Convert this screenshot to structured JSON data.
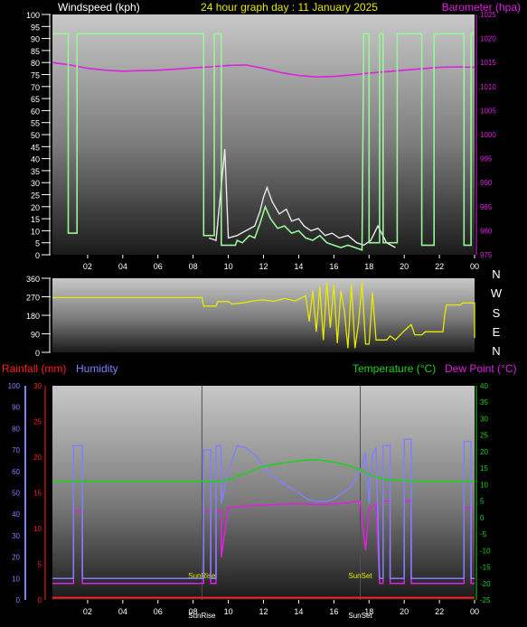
{
  "title": "24 hour graph day : 11 January 2025",
  "colors": {
    "windspeed": "#98f598",
    "gust": "#e8e8e8",
    "windspeed_label": "#ffffff",
    "barometer": "#e020e0",
    "title": "#e8e800",
    "direction": "#e8e800",
    "rain": "#ff2020",
    "humidity": "#8080ff",
    "temperature": "#20d020",
    "dewpoint": "#e020e0",
    "axis_text": "#ffffff",
    "sun_text": "#e8e800"
  },
  "hour_ticks": [
    "02",
    "04",
    "06",
    "08",
    "10",
    "12",
    "14",
    "16",
    "18",
    "20",
    "22",
    "00"
  ],
  "chart_data": [
    {
      "type": "line",
      "name": "wind-barometer",
      "title": "24 hour graph day : 11 January 2025",
      "left_label": "Windspeed (kph)",
      "right_label": "Barometer (hpa)",
      "left_ticks": [
        "100",
        "95",
        "90",
        "85",
        "80",
        "75",
        "70",
        "65",
        "60",
        "55",
        "50",
        "45",
        "40",
        "35",
        "30",
        "25",
        "20",
        "15",
        "10",
        "5",
        "0"
      ],
      "right_ticks": [
        "1025",
        "1020",
        "1015",
        "1010",
        "1005",
        "1000",
        "995",
        "990",
        "985",
        "980",
        "975"
      ],
      "ylim_left": [
        0,
        100
      ],
      "ylim_right": [
        975,
        1025
      ],
      "x_range_hours": [
        0,
        24
      ],
      "wind_avg": [
        [
          0,
          92
        ],
        [
          0.9,
          92
        ],
        [
          0.9,
          9
        ],
        [
          1.4,
          9
        ],
        [
          1.4,
          92
        ],
        [
          8.6,
          92
        ],
        [
          8.6,
          8
        ],
        [
          9.2,
          8
        ],
        [
          9.2,
          92
        ],
        [
          9.6,
          92
        ],
        [
          9.6,
          4
        ],
        [
          10.4,
          4
        ],
        [
          10.5,
          6
        ],
        [
          10.8,
          5
        ],
        [
          11.2,
          8
        ],
        [
          11.5,
          7
        ],
        [
          11.8,
          13
        ],
        [
          12.1,
          20
        ],
        [
          12.4,
          15
        ],
        [
          12.8,
          11
        ],
        [
          13.2,
          12
        ],
        [
          13.6,
          9
        ],
        [
          14.0,
          10
        ],
        [
          14.4,
          7
        ],
        [
          14.8,
          6
        ],
        [
          15.2,
          8
        ],
        [
          15.6,
          5
        ],
        [
          16.0,
          4
        ],
        [
          16.4,
          3
        ],
        [
          16.8,
          4
        ],
        [
          17.2,
          3
        ],
        [
          17.6,
          2
        ],
        [
          17.7,
          92
        ],
        [
          18.0,
          92
        ],
        [
          18.0,
          5
        ],
        [
          18.6,
          5
        ],
        [
          18.6,
          92
        ],
        [
          18.8,
          92
        ],
        [
          18.8,
          5
        ],
        [
          19.6,
          5
        ],
        [
          19.6,
          92
        ],
        [
          21.0,
          92
        ],
        [
          21.0,
          4
        ],
        [
          21.7,
          4
        ],
        [
          21.7,
          92
        ],
        [
          23.4,
          92
        ],
        [
          23.4,
          4
        ],
        [
          23.8,
          4
        ],
        [
          23.8,
          92
        ],
        [
          24,
          92
        ]
      ],
      "wind_gust": [
        [
          8.9,
          7
        ],
        [
          9.3,
          6
        ],
        [
          9.8,
          44
        ],
        [
          10.0,
          7
        ],
        [
          10.5,
          8
        ],
        [
          11.0,
          10
        ],
        [
          11.5,
          12
        ],
        [
          11.8,
          18
        ],
        [
          12.0,
          24
        ],
        [
          12.2,
          28
        ],
        [
          12.5,
          22
        ],
        [
          12.9,
          17
        ],
        [
          13.3,
          19
        ],
        [
          13.6,
          14
        ],
        [
          14.0,
          15
        ],
        [
          14.3,
          12
        ],
        [
          14.7,
          10
        ],
        [
          15.1,
          11
        ],
        [
          15.5,
          8
        ],
        [
          15.9,
          9
        ],
        [
          16.3,
          7
        ],
        [
          16.8,
          8
        ],
        [
          17.3,
          5
        ],
        [
          17.7,
          4
        ],
        [
          18.1,
          6
        ],
        [
          18.5,
          12
        ],
        [
          19.0,
          5
        ],
        [
          19.5,
          3
        ]
      ],
      "barometer": [
        [
          0,
          1015
        ],
        [
          1,
          1014.5
        ],
        [
          2,
          1013.8
        ],
        [
          3,
          1013.4
        ],
        [
          4,
          1013.2
        ],
        [
          5,
          1013.3
        ],
        [
          6,
          1013.4
        ],
        [
          7,
          1013.6
        ],
        [
          8,
          1013.9
        ],
        [
          9,
          1014.1
        ],
        [
          10,
          1014.4
        ],
        [
          11,
          1014.5
        ],
        [
          12,
          1013.8
        ],
        [
          13,
          1012.9
        ],
        [
          14,
          1012.3
        ],
        [
          15,
          1012.0
        ],
        [
          16,
          1012.1
        ],
        [
          17,
          1012.4
        ],
        [
          18,
          1012.8
        ],
        [
          19,
          1013.1
        ],
        [
          20,
          1013.4
        ],
        [
          21,
          1013.7
        ],
        [
          22,
          1014.0
        ],
        [
          23,
          1014.1
        ],
        [
          24,
          1014.0
        ]
      ]
    },
    {
      "type": "line",
      "name": "wind-direction",
      "left_ticks": [
        "360",
        "270",
        "180",
        "90",
        "0"
      ],
      "right_labels": [
        "N",
        "W",
        "S",
        "E",
        "N"
      ],
      "ylim": [
        0,
        360
      ],
      "x_range_hours": [
        0,
        24
      ],
      "direction": [
        [
          0,
          266
        ],
        [
          8.5,
          266
        ],
        [
          8.6,
          225
        ],
        [
          9.3,
          225
        ],
        [
          9.4,
          247
        ],
        [
          10.0,
          247
        ],
        [
          10.2,
          235
        ],
        [
          10.8,
          240
        ],
        [
          11.4,
          250
        ],
        [
          12.0,
          255
        ],
        [
          12.6,
          248
        ],
        [
          13.2,
          262
        ],
        [
          13.8,
          250
        ],
        [
          14.4,
          275
        ],
        [
          14.6,
          150
        ],
        [
          14.8,
          300
        ],
        [
          15.0,
          100
        ],
        [
          15.2,
          320
        ],
        [
          15.4,
          60
        ],
        [
          15.6,
          340
        ],
        [
          15.8,
          120
        ],
        [
          16.0,
          330
        ],
        [
          16.2,
          45
        ],
        [
          16.4,
          300
        ],
        [
          16.6,
          200
        ],
        [
          16.8,
          20
        ],
        [
          17.0,
          330
        ],
        [
          17.2,
          20
        ],
        [
          17.4,
          140
        ],
        [
          17.6,
          340
        ],
        [
          17.8,
          40
        ],
        [
          18.0,
          40
        ],
        [
          18.2,
          290
        ],
        [
          18.4,
          60
        ],
        [
          19.0,
          60
        ],
        [
          19.2,
          80
        ],
        [
          19.5,
          60
        ],
        [
          20.0,
          105
        ],
        [
          20.4,
          135
        ],
        [
          20.6,
          85
        ],
        [
          21.0,
          85
        ],
        [
          21.2,
          100
        ],
        [
          22.2,
          100
        ],
        [
          22.3,
          180
        ],
        [
          22.4,
          230
        ],
        [
          23.2,
          230
        ],
        [
          23.3,
          240
        ],
        [
          24,
          240
        ],
        [
          24,
          70
        ]
      ]
    },
    {
      "type": "line",
      "name": "rain-humidity-temperature",
      "top_labels": [
        "Rainfall (mm)",
        "Humidity",
        "Temperature (°C)",
        "Dew Point (°C)"
      ],
      "humidity_ticks": [
        "100",
        "90",
        "80",
        "70",
        "60",
        "50",
        "40",
        "30",
        "20",
        "10",
        "0"
      ],
      "rain_ticks": [
        "30",
        "25",
        "20",
        "15",
        "10",
        "5",
        "0"
      ],
      "temp_ticks": [
        "40",
        "35",
        "30",
        "25",
        "20",
        "15",
        "10",
        "5",
        "0",
        "-5",
        "-10",
        "-15",
        "-20",
        "-25"
      ],
      "ylim_humidity": [
        0,
        100
      ],
      "ylim_rain": [
        0,
        30
      ],
      "ylim_temperature": [
        -25,
        40
      ],
      "x_range_hours": [
        0,
        24
      ],
      "sun_labels": [
        "SunRise",
        "SunSet"
      ],
      "sun_bottom_labels": [
        "SunRise",
        "SunSet"
      ],
      "sun_hours": [
        8.5,
        17.5
      ],
      "rainfall": [
        [
          0,
          0.3
        ],
        [
          24,
          0.3
        ]
      ],
      "humidity": [
        [
          0,
          10
        ],
        [
          1.2,
          10
        ],
        [
          1.2,
          72
        ],
        [
          1.7,
          72
        ],
        [
          1.7,
          10
        ],
        [
          8.6,
          10
        ],
        [
          8.6,
          70
        ],
        [
          9.0,
          70
        ],
        [
          9.0,
          10
        ],
        [
          9.3,
          10
        ],
        [
          9.3,
          72
        ],
        [
          9.6,
          72
        ],
        [
          9.6,
          45
        ],
        [
          10.0,
          60
        ],
        [
          10.5,
          72
        ],
        [
          11.0,
          71
        ],
        [
          11.6,
          67
        ],
        [
          12.2,
          60
        ],
        [
          12.8,
          56
        ],
        [
          13.4,
          53
        ],
        [
          14.0,
          50
        ],
        [
          14.5,
          47
        ],
        [
          15.0,
          46
        ],
        [
          15.5,
          46
        ],
        [
          16.0,
          47
        ],
        [
          16.5,
          50
        ],
        [
          17.0,
          53
        ],
        [
          17.5,
          60
        ],
        [
          17.8,
          69
        ],
        [
          18.0,
          45
        ],
        [
          18.2,
          68
        ],
        [
          18.4,
          71
        ],
        [
          18.6,
          10
        ],
        [
          18.8,
          10
        ],
        [
          18.8,
          72
        ],
        [
          19.2,
          72
        ],
        [
          19.2,
          10
        ],
        [
          20.0,
          10
        ],
        [
          20.0,
          75
        ],
        [
          20.4,
          75
        ],
        [
          20.4,
          10
        ],
        [
          23.4,
          10
        ],
        [
          23.4,
          74
        ],
        [
          23.8,
          74
        ],
        [
          23.8,
          10
        ],
        [
          24,
          10
        ]
      ],
      "temperature": [
        [
          0,
          11
        ],
        [
          9.5,
          11
        ],
        [
          10.0,
          11.5
        ],
        [
          10.5,
          12.5
        ],
        [
          11.0,
          13.5
        ],
        [
          11.5,
          14.5
        ],
        [
          12.0,
          15.5
        ],
        [
          12.5,
          16
        ],
        [
          13.0,
          16.5
        ],
        [
          13.5,
          16.8
        ],
        [
          14.0,
          17.2
        ],
        [
          14.5,
          17.5
        ],
        [
          15.0,
          17.5
        ],
        [
          15.5,
          17.2
        ],
        [
          16.0,
          16.8
        ],
        [
          16.5,
          16.2
        ],
        [
          17.0,
          15.5
        ],
        [
          17.5,
          14.5
        ],
        [
          18.0,
          13.0
        ],
        [
          18.5,
          12.0
        ],
        [
          19.0,
          11.5
        ],
        [
          20.0,
          11.2
        ],
        [
          21.0,
          11
        ],
        [
          24,
          11
        ]
      ],
      "dewpoint": [
        [
          0,
          -20
        ],
        [
          1.2,
          -20
        ],
        [
          1.2,
          2
        ],
        [
          1.7,
          2
        ],
        [
          1.7,
          -20
        ],
        [
          8.6,
          -20
        ],
        [
          8.6,
          2
        ],
        [
          9.0,
          2
        ],
        [
          9.0,
          -20
        ],
        [
          9.3,
          -20
        ],
        [
          9.3,
          2
        ],
        [
          9.6,
          2
        ],
        [
          9.6,
          -12
        ],
        [
          10.0,
          3
        ],
        [
          11.0,
          3.5
        ],
        [
          12.0,
          3.8
        ],
        [
          13.0,
          4
        ],
        [
          14.0,
          4.2
        ],
        [
          14.8,
          4
        ],
        [
          15.5,
          4
        ],
        [
          16.5,
          4.3
        ],
        [
          17.5,
          5
        ],
        [
          17.8,
          -10
        ],
        [
          18.0,
          3
        ],
        [
          18.4,
          4
        ],
        [
          18.6,
          -20
        ],
        [
          18.8,
          -20
        ],
        [
          18.8,
          5
        ],
        [
          19.2,
          5
        ],
        [
          19.2,
          -20
        ],
        [
          20.0,
          -20
        ],
        [
          20.0,
          5
        ],
        [
          20.4,
          5
        ],
        [
          20.4,
          -20
        ],
        [
          23.4,
          -20
        ],
        [
          23.4,
          3
        ],
        [
          23.8,
          3
        ],
        [
          23.8,
          -20
        ],
        [
          24,
          -20
        ]
      ]
    }
  ]
}
